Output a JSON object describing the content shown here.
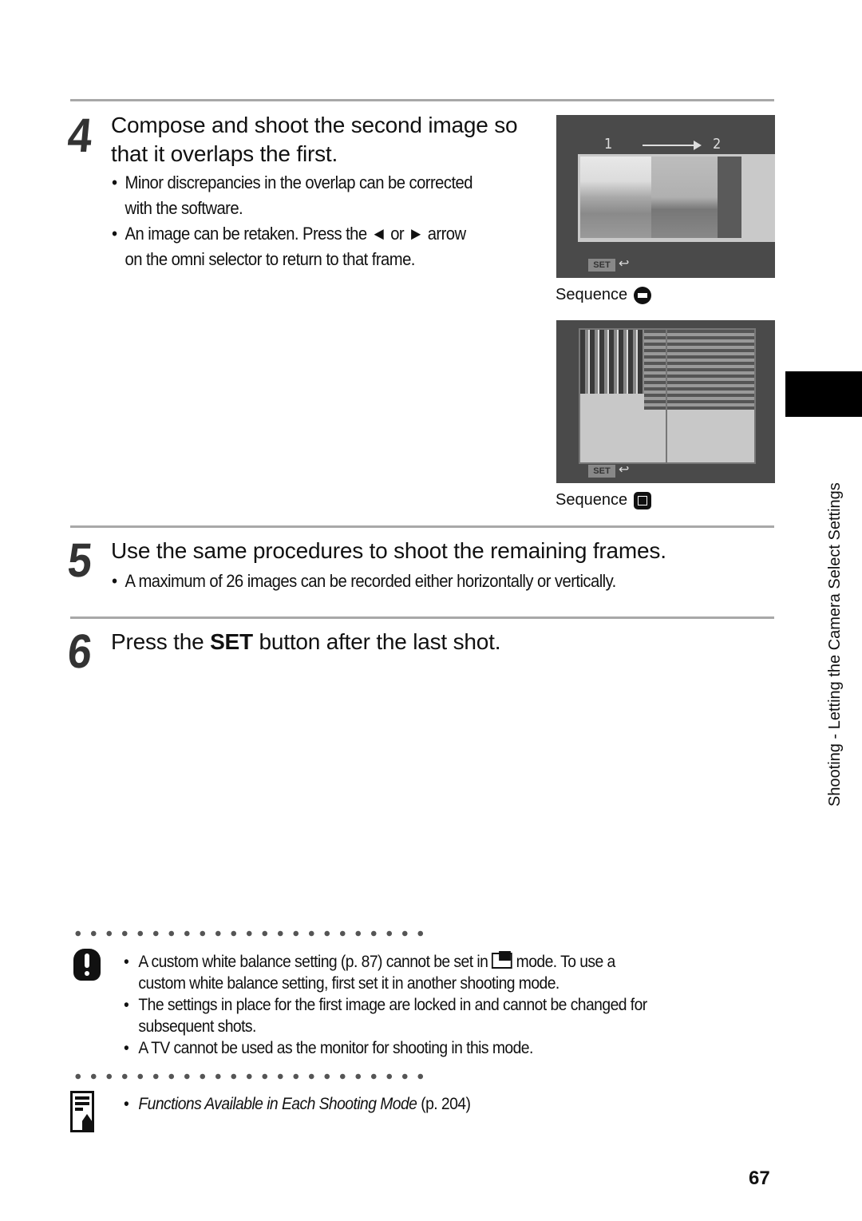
{
  "steps": [
    {
      "number": "4",
      "heading_line1": "Compose and shoot the second image so",
      "heading_line2": "that it overlaps the first.",
      "bullets": [
        {
          "line1": "Minor discrepancies in the overlap can be corrected",
          "line2": "with the software."
        },
        {
          "line1": "An image can be retaken. Press the ◄ or ► arrow",
          "line2": "on the omni selector to return to that frame."
        }
      ]
    },
    {
      "number": "5",
      "heading": "Use the same procedures to shoot the remaining frames.",
      "bullets": [
        {
          "line1": "A maximum of 26 images can be recorded either horizontally or vertically."
        }
      ]
    },
    {
      "number": "6",
      "heading_pre": "Press the ",
      "heading_bold": "SET",
      "heading_post": " button after the last shot."
    }
  ],
  "figures": [
    {
      "caption": "Sequence",
      "mode_icon": "horizontal-sequence-icon",
      "frame_labels": [
        "1",
        "2"
      ],
      "set_label": "SET",
      "return_icon": "↩"
    },
    {
      "caption": "Sequence",
      "mode_icon": "clockwise-sequence-icon",
      "set_label": "SET",
      "return_icon": "↩"
    }
  ],
  "caution": {
    "icon": "caution-icon",
    "bullets": [
      {
        "line1_pre": "A custom white balance setting (p. 87) cannot be set in ",
        "line1_post": " mode. To use a",
        "line2": "custom white balance setting, first set it in another shooting mode."
      },
      {
        "line1": "The settings in place for the first image are locked in and cannot be changed for",
        "line2": "subsequent shots."
      },
      {
        "line1": "A TV cannot be used as the monitor for shooting in this mode."
      }
    ]
  },
  "reference": {
    "icon": "reference-note-icon",
    "italic": "Functions Available in Each Shooting Mode",
    "page_ref": " (p. 204)"
  },
  "side_tab_label": "Shooting - Letting the Camera Select Settings",
  "page_number": "67",
  "colors": {
    "rule": "#a8a8a8",
    "screen_bg": "#4a4a4a",
    "tab": "#000000"
  }
}
